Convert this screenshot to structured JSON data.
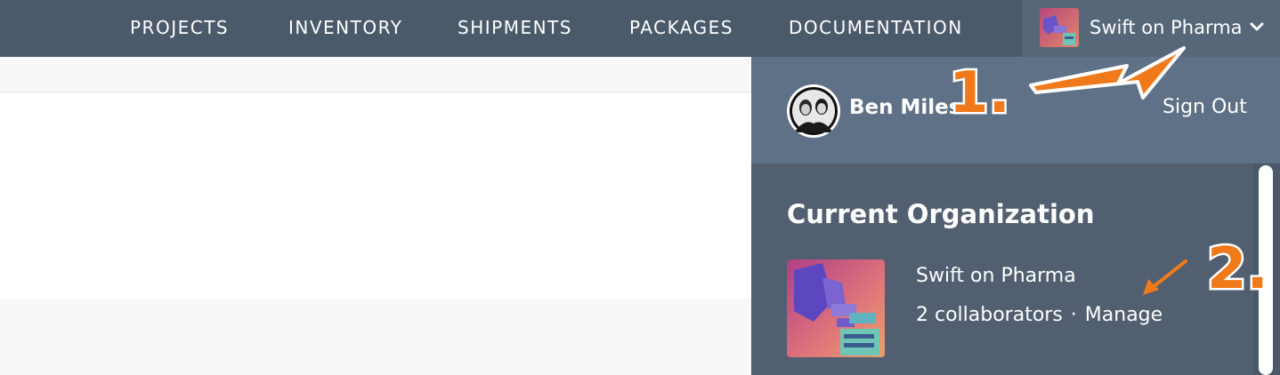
{
  "nav": {
    "items": [
      {
        "label": "PROJECTS"
      },
      {
        "label": "INVENTORY"
      },
      {
        "label": "SHIPMENTS"
      },
      {
        "label": "PACKAGES"
      },
      {
        "label": "DOCUMENTATION"
      }
    ],
    "org_switcher": {
      "label": "Swift on Pharma",
      "icon": "chevron-down-icon"
    }
  },
  "dropdown": {
    "user": {
      "name": "Ben Miles",
      "sign_out_label": "Sign Out"
    },
    "current_org": {
      "heading": "Current Organization",
      "name": "Swift on Pharma",
      "collaborators": "2 collaborators",
      "separator": "·",
      "manage_label": "Manage"
    }
  },
  "annotations": {
    "step1": "1.",
    "step2": "2.",
    "color": "#f07a1a"
  }
}
